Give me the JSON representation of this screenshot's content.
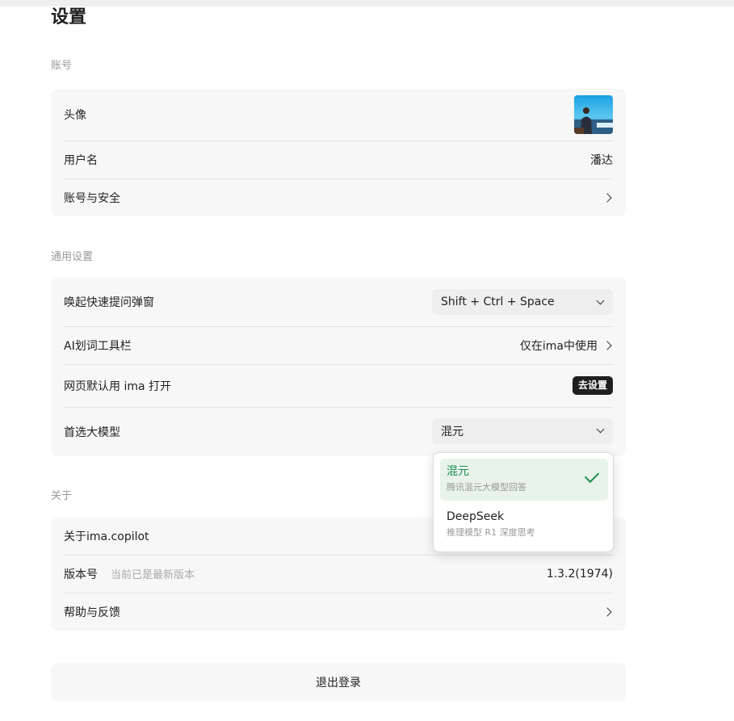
{
  "page": {
    "title": "设置"
  },
  "account": {
    "section_label": "账号",
    "avatar_label": "头像",
    "username_label": "用户名",
    "username_value": "潘达",
    "security_label": "账号与安全"
  },
  "general": {
    "section_label": "通用设置",
    "hotkey_label": "唤起快速提问弹窗",
    "hotkey_value": "Shift + Ctrl + Space",
    "ai_toolbar_label": "AI划词工具栏",
    "ai_toolbar_value": "仅在ima中使用",
    "default_open_label": "网页默认用 ima 打开",
    "default_open_button": "去设置",
    "model_label": "首选大模型",
    "model_value": "混元"
  },
  "model_dropdown": {
    "options": [
      {
        "title": "混元",
        "desc": "腾讯混元大模型回答",
        "selected": true
      },
      {
        "title": "DeepSeek",
        "desc": "推理模型 R1 深度思考",
        "selected": false
      }
    ]
  },
  "about": {
    "section_label": "关于",
    "about_label": "关于ima.copilot",
    "version_label": "版本号",
    "version_hint": "当前已是最新版本",
    "version_value": "1.3.2(1974)",
    "help_label": "帮助与反馈"
  },
  "logout_label": "退出登录",
  "colors": {
    "accent": "#1a8f4c",
    "selected_bg": "#e8f3ec",
    "card_bg": "#f7f7f7"
  }
}
